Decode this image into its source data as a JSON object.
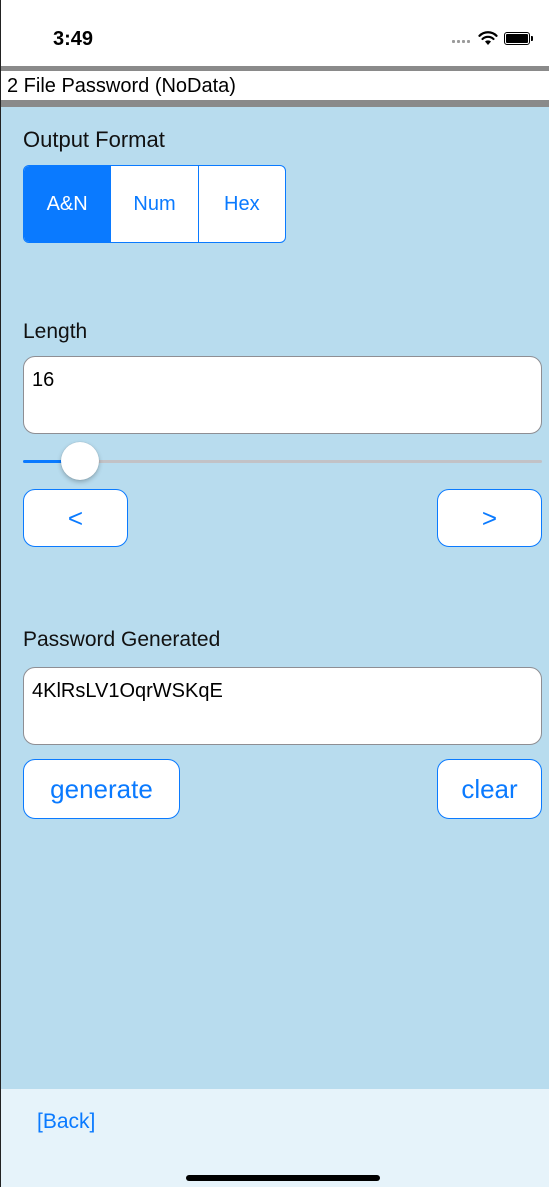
{
  "status_bar": {
    "time": "3:49",
    "icons": [
      "cellular-signal-icon",
      "wifi-icon",
      "battery-icon"
    ]
  },
  "header": {
    "title": "2 File Password (NoData)"
  },
  "output_format": {
    "label": "Output Format",
    "options": [
      "A&N",
      "Num",
      "Hex"
    ],
    "selected": "A&N"
  },
  "length": {
    "label": "Length",
    "value": "16",
    "slider_fraction": 0.08,
    "prev_label": "<",
    "next_label": ">"
  },
  "password": {
    "label": "Password Generated",
    "value": "4KlRsLV1OqrWSKqE",
    "generate_label": "generate",
    "clear_label": "clear"
  },
  "footer": {
    "back_label": "[Back]"
  },
  "colors": {
    "accent": "#0a7aff",
    "main_background": "#b8dcee",
    "footer_background": "#e6f3fa",
    "header_rule": "#8a8a8a"
  }
}
